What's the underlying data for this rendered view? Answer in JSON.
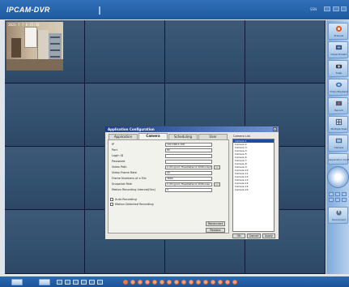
{
  "app": {
    "logo": "IPCAM-DVR",
    "top_right_label": "SSN",
    "colors": {
      "header": "#2467b0",
      "grid_bg": "#11193b",
      "cell": "#35526f",
      "accent": "#f07c3e"
    }
  },
  "camera_view": {
    "timestamp": "2021-7-7  8:15:58",
    "active_cell": 1
  },
  "dialog": {
    "title": "Application Configuration",
    "close_glyph": "x",
    "tabs": [
      {
        "label": "Application",
        "active": false
      },
      {
        "label": "Camera",
        "active": true
      },
      {
        "label": "Scheduling",
        "active": false
      },
      {
        "label": "User",
        "active": false
      }
    ],
    "fields": [
      {
        "label": "IP",
        "value": "192.168.0.108"
      },
      {
        "label": "Port",
        "value": "80"
      },
      {
        "label": "Login ID",
        "value": ""
      },
      {
        "label": "Password",
        "value": ""
      },
      {
        "label": "Video Path",
        "value": "C:\\Program Files\\Network DVR\\video\\"
      },
      {
        "label": "Video Frame Rate",
        "value": "20"
      },
      {
        "label": "Frame Numbers of a File",
        "value": "3600"
      },
      {
        "label": "Snapshot Path",
        "value": "C:\\Program Files\\Network DVR\\snap"
      },
      {
        "label": "Motion Recording Interval(Sec)",
        "value": "3"
      }
    ],
    "browse_label": "...",
    "checkboxes": [
      {
        "label": "Auto Recording",
        "checked": false
      },
      {
        "label": "Motion Detected Recording",
        "checked": false
      }
    ],
    "buttons": {
      "reconnect": "Reconnect",
      "restore": "Restore",
      "ok": "OK",
      "cancel": "Cancel",
      "apply": "Apply"
    },
    "camera_list_label": "Camera List",
    "camera_list": [
      "Camera 1",
      "Camera 2",
      "Camera 3",
      "Camera 4",
      "Camera 5",
      "Camera 6",
      "Camera 7",
      "Camera 8",
      "Camera 9",
      "Camera 10",
      "Camera 11",
      "Camera 12",
      "Camera 13",
      "Camera 14",
      "Camera 15",
      "Camera 16"
    ],
    "selected_camera_index": 0
  },
  "sidebar": {
    "buttons": [
      {
        "label": "Preview",
        "icon": "eye-icon"
      },
      {
        "label": "Close Stream",
        "icon": "stop-icon"
      },
      {
        "label": "Snap",
        "icon": "camera-icon"
      },
      {
        "label": "Video Playback",
        "icon": "film-icon"
      },
      {
        "label": "Record",
        "icon": "record-icon"
      },
      {
        "label": "Multiple View",
        "icon": "grid-icon"
      },
      {
        "label": "Camera",
        "icon": "camera-settings-icon"
      },
      {
        "label": "Application Configuration",
        "icon": "gear-icon"
      },
      {
        "label": "Disconnect",
        "icon": "disconnect-icon"
      }
    ]
  },
  "bottombar": {
    "layout_options": [
      "1x1",
      "2x2",
      "3x3",
      "4x4",
      "5x5",
      "6x6"
    ],
    "channel_count": 16,
    "active_channel": 1
  }
}
